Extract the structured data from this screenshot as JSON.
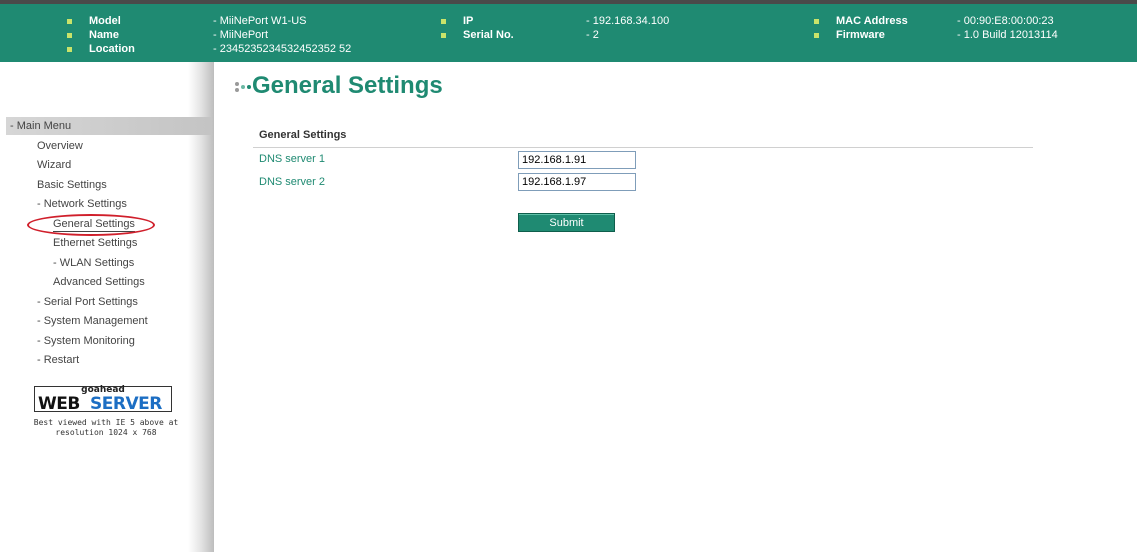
{
  "header": {
    "left": [
      {
        "label": "Model",
        "value": "- MiiNePort W1-US"
      },
      {
        "label": "Name",
        "value": "- MiiNePort"
      },
      {
        "label": "Location",
        "value": "- 2345235234532452352 52"
      }
    ],
    "mid": [
      {
        "label": "IP",
        "value": "- 192.168.34.100"
      },
      {
        "label": "Serial No.",
        "value": "- 2"
      }
    ],
    "right": [
      {
        "label": "MAC Address",
        "value": "- 00:90:E8:00:00:23"
      },
      {
        "label": "Firmware",
        "value": "- 1.0 Build 12013114"
      }
    ],
    "accent_color": "#1f8a72",
    "bullet_color": "#c9e36a"
  },
  "sidebar": {
    "main_menu": "- Main Menu",
    "items": [
      "Overview",
      "Wizard",
      "Basic Settings",
      "- Network Settings",
      "General Settings",
      "Ethernet Settings",
      "- WLAN Settings",
      "Advanced Settings",
      "- Serial Port Settings",
      "- System Management",
      "- System Monitoring",
      "- Restart"
    ],
    "logo": {
      "top": "goahead",
      "web": "WEB",
      "server": "SERVER"
    },
    "best_viewed_line1": "Best viewed with IE 5 above at",
    "best_viewed_line2": "resolution 1024 x 768"
  },
  "main": {
    "title": "General Settings",
    "section_title": "General Settings",
    "fields": [
      {
        "label": "DNS server 1",
        "value": "192.168.1.91"
      },
      {
        "label": "DNS server 2",
        "value": "192.168.1.97"
      }
    ],
    "submit_label": "Submit"
  }
}
